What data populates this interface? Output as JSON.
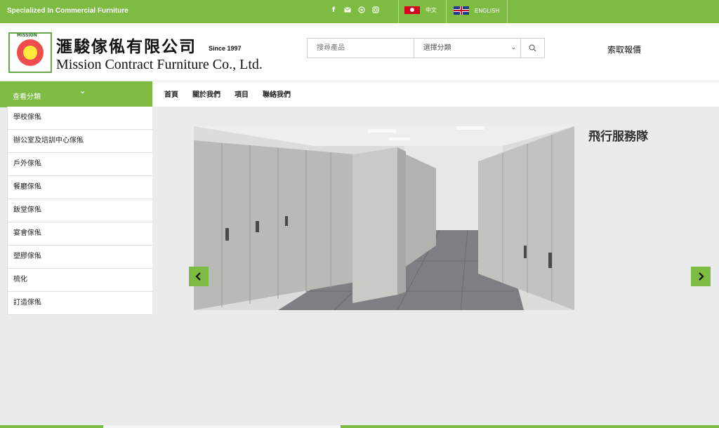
{
  "topbar": {
    "tagline": "Specialized In Commercial Furniture",
    "social_icons": [
      "facebook-icon",
      "email-icon",
      "whatsapp-icon",
      "instagram-icon"
    ],
    "languages": [
      {
        "flag": "hk-flag",
        "label": "中文"
      },
      {
        "flag": "uk-flag",
        "label": "ENGLISH"
      }
    ],
    "color": "#7dbb42"
  },
  "header": {
    "logo_text": "MISSION",
    "company_zh": "滙駿傢俬有限公司",
    "since": "Since 1997",
    "company_en": "Mission Contract Furniture Co., Ltd.",
    "search_placeholder": "搜尋產品",
    "category_select": "選擇分類",
    "quote_link": "索取報價"
  },
  "nav": {
    "category_toggle": "查看分類",
    "menu": [
      "首頁",
      "關於我們",
      "項目",
      "聯絡我們"
    ]
  },
  "sidebar": {
    "items": [
      "學校傢俬",
      "辦公室及培訓中心傢俬",
      "戶外傢俬",
      "餐廳傢俬",
      "飯堂傢俬",
      "宴會傢俬",
      "塑膠傢俬",
      "梳化",
      "訂造傢俬"
    ]
  },
  "slider": {
    "title": "飛行服務隊"
  }
}
